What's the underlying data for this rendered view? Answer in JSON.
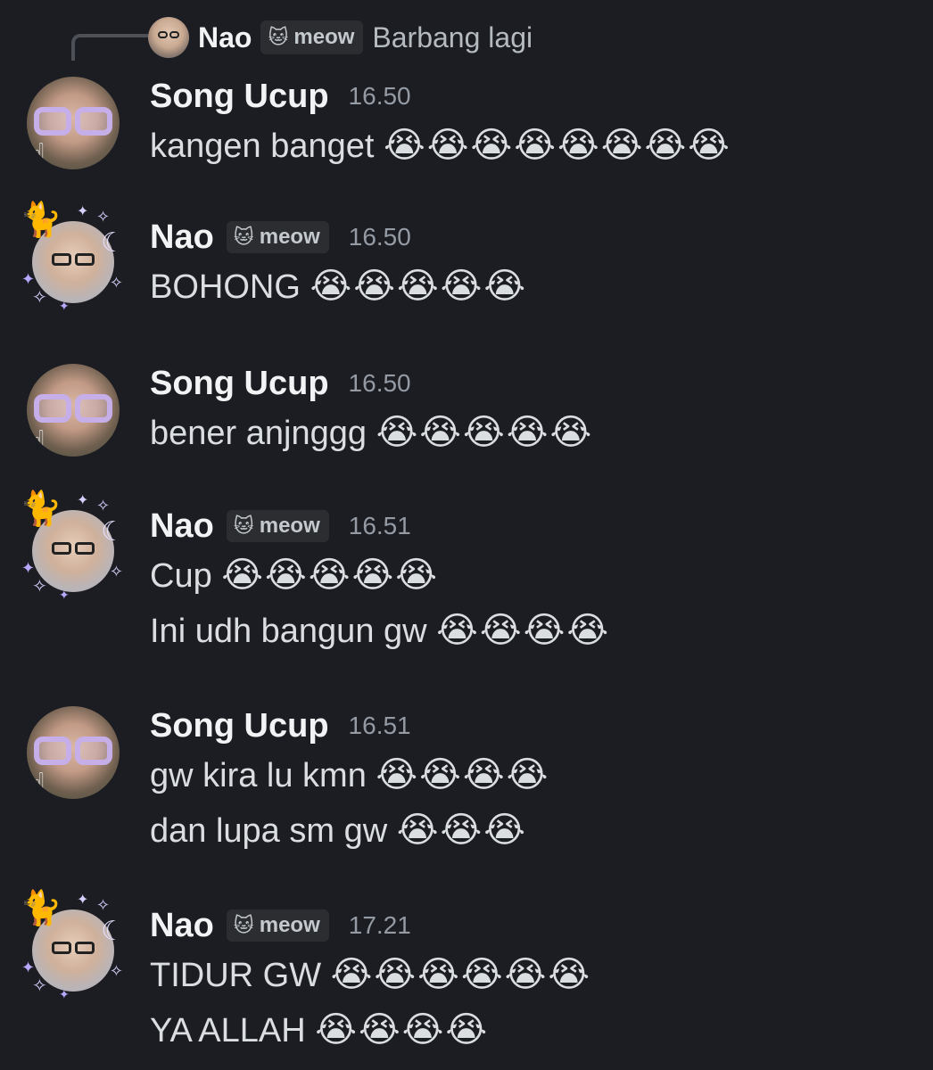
{
  "reply": {
    "author": "Nao",
    "tag_icon": "cat-icon",
    "tag_label": "meow",
    "text": "Barbang lagi"
  },
  "messages": [
    {
      "author": "Song Ucup",
      "avatar": "ucup",
      "time": "16.50",
      "has_tag": false,
      "lines": [
        {
          "text": "kangen banget",
          "emoji": "😭😭😭😭😭😭😭😭"
        }
      ]
    },
    {
      "author": "Nao",
      "avatar": "nao",
      "time": "16.50",
      "has_tag": true,
      "tag_label": "meow",
      "lines": [
        {
          "text": "BOHONG",
          "emoji": "😭😭😭😭😭"
        }
      ]
    },
    {
      "author": "Song Ucup",
      "avatar": "ucup",
      "time": "16.50",
      "has_tag": false,
      "lines": [
        {
          "text": "bener anjnggg",
          "emoji": "😭😭😭😭😭"
        }
      ]
    },
    {
      "author": "Nao",
      "avatar": "nao",
      "time": "16.51",
      "has_tag": true,
      "tag_label": "meow",
      "lines": [
        {
          "text": "Cup",
          "emoji": "😭😭😭😭😭"
        },
        {
          "text": "Ini udh bangun gw",
          "emoji": "😭😭😭😭"
        }
      ]
    },
    {
      "author": "Song Ucup",
      "avatar": "ucup",
      "time": "16.51",
      "has_tag": false,
      "lines": [
        {
          "text": "gw kira lu kmn",
          "emoji": "😭😭😭😭"
        },
        {
          "text": "dan lupa sm gw",
          "emoji": "😭😭😭"
        }
      ]
    },
    {
      "author": "Nao",
      "avatar": "nao",
      "time": "17.21",
      "has_tag": true,
      "tag_label": "meow",
      "lines": [
        {
          "text": "TIDUR GW",
          "emoji": "😭😭😭😭😭😭"
        },
        {
          "text": "YA ALLAH",
          "emoji": "😭😭😭😭"
        }
      ]
    }
  ],
  "colors": {
    "background": "#1c1d22",
    "name": "#f2f3f5",
    "text": "#dbdee1",
    "timestamp": "#949ba4",
    "tag_background": "#2b2d31"
  }
}
